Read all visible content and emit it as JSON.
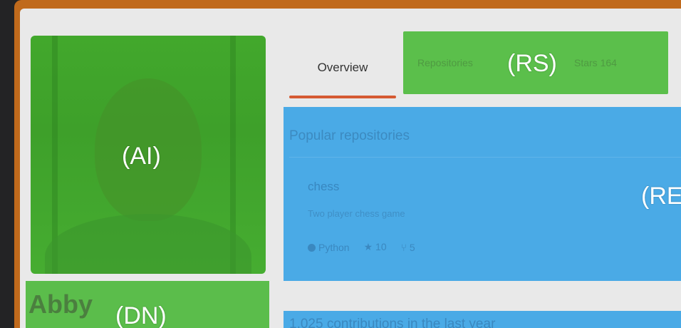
{
  "profile": {
    "avatar_label": "(AI)",
    "display_name": "Abby",
    "display_name_label": "(DN)"
  },
  "tabs": {
    "overview": "Overview",
    "repositories": "Repositories",
    "stars": "Stars",
    "stars_count": "164",
    "section_label": "(RS)"
  },
  "repos": {
    "section_title": "Popular repositories",
    "section_label": "(RE)",
    "items": [
      {
        "name": "chess",
        "description": "Two player chess game",
        "language": "Python",
        "stars": "10",
        "forks": "5"
      }
    ]
  },
  "contributions": {
    "summary": "1,025 contributions in the last year"
  },
  "colors": {
    "accent": "#d55a32",
    "highlight_green": "#5bbf4b",
    "highlight_blue": "#4aaae6",
    "frame": "#c06a1c"
  }
}
